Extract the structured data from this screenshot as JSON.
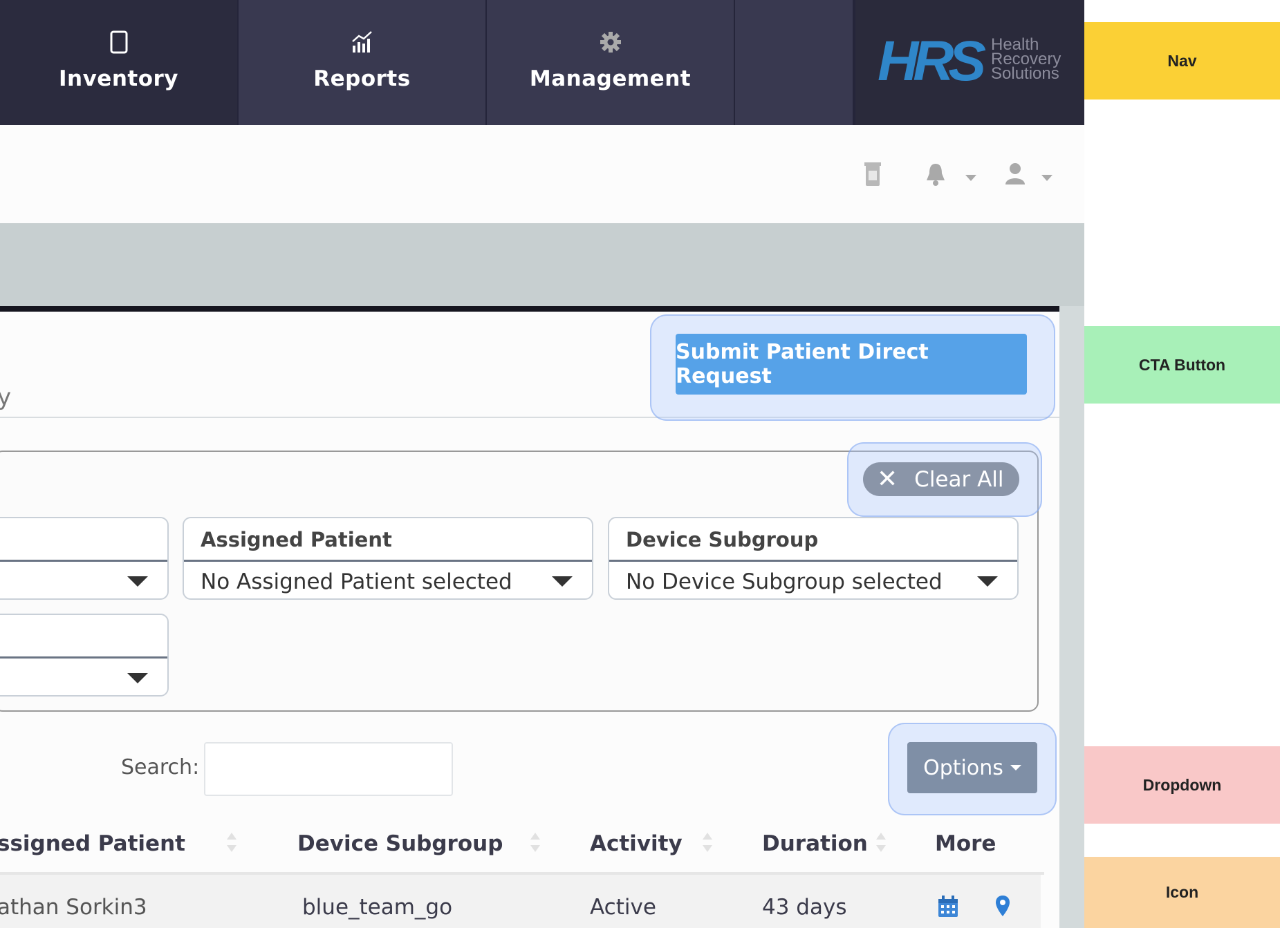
{
  "nav": {
    "items": [
      {
        "label": "Inventory",
        "icon": "tablet-icon"
      },
      {
        "label": "Reports",
        "icon": "chart-icon"
      },
      {
        "label": "Management",
        "icon": "gear-icon"
      }
    ],
    "logo": {
      "text": "HRS",
      "tagline_1": "Health",
      "tagline_2": "Recovery",
      "tagline_3": "Solutions"
    }
  },
  "header": {
    "icons": [
      "device-icon",
      "bell-icon",
      "user-icon"
    ]
  },
  "panel": {
    "partial_text": "y",
    "submit_button": "Submit Patient Direct Request"
  },
  "filters": {
    "clear_all": "Clear All",
    "assigned_patient": {
      "label": "Assigned Patient",
      "value": "No Assigned Patient selected"
    },
    "device_subgroup": {
      "label": "Device Subgroup",
      "value": "No Device Subgroup selected"
    }
  },
  "search": {
    "label": "Search:",
    "value": ""
  },
  "options_button": "Options",
  "table": {
    "headers": [
      "ssigned Patient",
      "Device Subgroup",
      "Activity",
      "Duration",
      "More"
    ],
    "rows": [
      {
        "patient": "athan Sorkin3",
        "subgroup": "blue_team_go",
        "activity": "Active",
        "duration": "43 days"
      }
    ]
  },
  "annotations": {
    "nav": "Nav",
    "cta": "CTA Button",
    "dropdown": "Dropdown",
    "icon": "Icon"
  },
  "colors": {
    "nav_bg": "#393950",
    "accent": "#56a2e8",
    "annot_nav": "#fbd035",
    "annot_cta": "#a8f0b8",
    "annot_dropdown": "#f9c8c8",
    "annot_icon": "#fbd4a0"
  }
}
